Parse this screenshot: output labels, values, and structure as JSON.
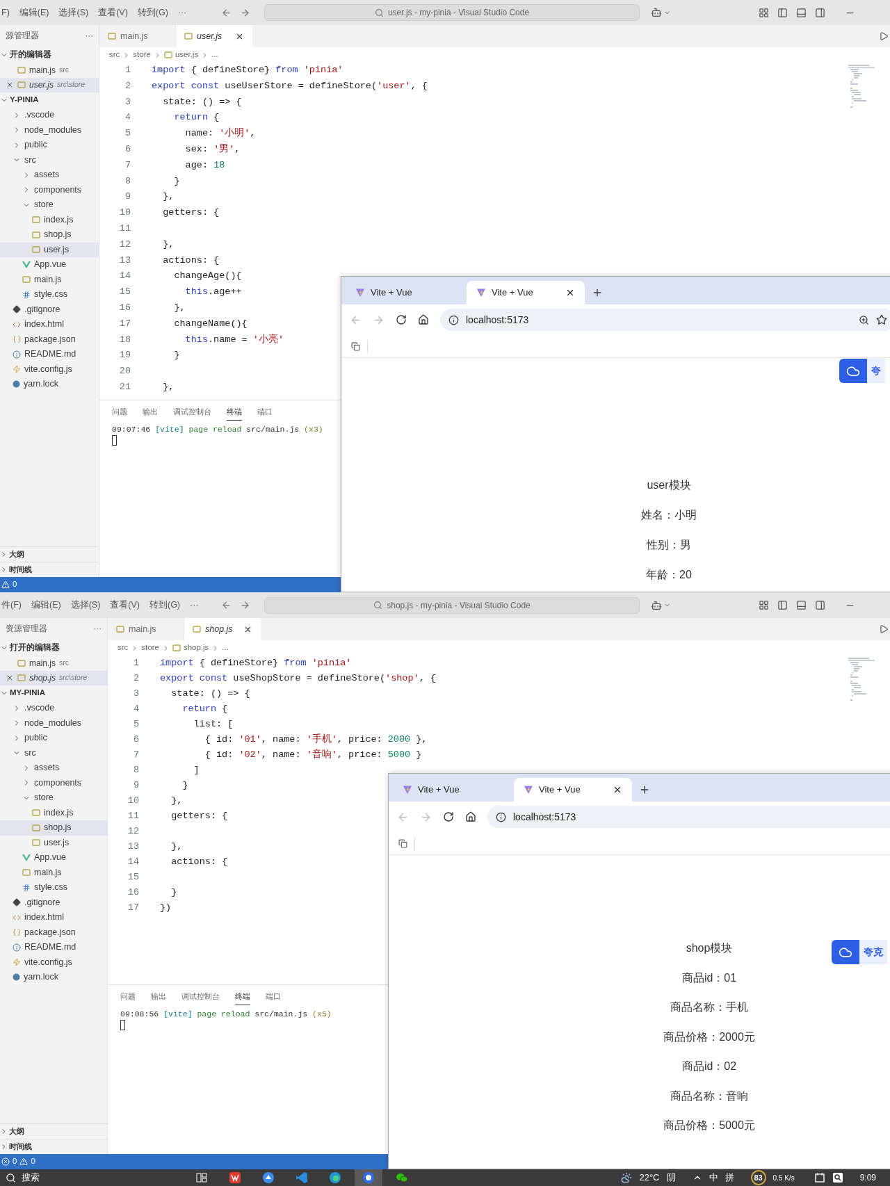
{
  "screens": [
    {
      "titlebar": {
        "menus": [
          "F)",
          "编辑(E)",
          "选择(S)",
          "查看(V)",
          "转到(G)"
        ],
        "more": "···",
        "search": "user.js - my-pinia - Visual Studio Code"
      },
      "explorer": {
        "title": "源管理器",
        "more": "···",
        "open_editors": {
          "title": "开的编辑器",
          "items": [
            {
              "name": "main.js",
              "path": "src",
              "selected": false,
              "preview": false
            },
            {
              "name": "user.js",
              "path": "src\\store",
              "selected": true,
              "preview": true
            }
          ]
        },
        "project": "Y-PINIA",
        "tree": [
          {
            "name": ".vscode",
            "kind": "folder",
            "expanded": false,
            "selected": false
          },
          {
            "name": "node_modules",
            "kind": "folder",
            "expanded": false,
            "selected": false
          },
          {
            "name": "public",
            "kind": "folder",
            "expanded": false,
            "selected": false
          },
          {
            "name": "src",
            "kind": "folder",
            "expanded": true,
            "selected": false,
            "children": [
              {
                "name": "assets",
                "kind": "folder",
                "expanded": false,
                "selected": false
              },
              {
                "name": "components",
                "kind": "folder",
                "expanded": false,
                "selected": false
              },
              {
                "name": "store",
                "kind": "folder",
                "expanded": true,
                "selected": false,
                "children": [
                  {
                    "name": "index.js",
                    "kind": "js",
                    "selected": false
                  },
                  {
                    "name": "shop.js",
                    "kind": "js",
                    "selected": false
                  },
                  {
                    "name": "user.js",
                    "kind": "js",
                    "selected": true
                  }
                ]
              },
              {
                "name": "App.vue",
                "kind": "vue",
                "selected": false
              },
              {
                "name": "main.js",
                "kind": "js",
                "selected": false
              },
              {
                "name": "style.css",
                "kind": "css",
                "selected": false
              }
            ]
          },
          {
            "name": ".gitignore",
            "kind": "git",
            "selected": false
          },
          {
            "name": "index.html",
            "kind": "html",
            "selected": false
          },
          {
            "name": "package.json",
            "kind": "json",
            "selected": false
          },
          {
            "name": "README.md",
            "kind": "md",
            "selected": false
          },
          {
            "name": "vite.config.js",
            "kind": "config",
            "selected": false
          },
          {
            "name": "yarn.lock",
            "kind": "lock",
            "selected": false
          }
        ],
        "outline": "大纲",
        "timeline": "时间线"
      },
      "tabs": [
        {
          "label": "main.js",
          "selected": false,
          "preview": false
        },
        {
          "label": "user.js",
          "selected": true,
          "preview": true
        }
      ],
      "breadcrumb": [
        "src",
        "store",
        "user.js",
        "..."
      ],
      "code": [
        {
          "number": "1",
          "tokens": [
            {
              "kind": "keyword",
              "text": "import"
            },
            {
              "kind": "plain",
              "text": " { defineStore} "
            },
            {
              "kind": "keyword",
              "text": "from "
            },
            {
              "kind": "string",
              "text": "'pinia'"
            }
          ]
        },
        {
          "number": "2",
          "tokens": [
            {
              "kind": "keyword",
              "text": "export const"
            },
            {
              "kind": "plain",
              "text": " useUserStore = defineStore("
            },
            {
              "kind": "string",
              "text": "'user'"
            },
            {
              "kind": "plain",
              "text": ", {"
            }
          ]
        },
        {
          "number": "3",
          "tokens": [
            {
              "kind": "plain",
              "text": "  state: () => {"
            }
          ]
        },
        {
          "number": "4",
          "tokens": [
            {
              "kind": "keyword",
              "text": "    return"
            },
            {
              "kind": "plain",
              "text": " {"
            }
          ]
        },
        {
          "number": "5",
          "tokens": [
            {
              "kind": "plain",
              "text": "      name: "
            },
            {
              "kind": "string",
              "text": "'小明'"
            },
            {
              "kind": "plain",
              "text": ","
            }
          ]
        },
        {
          "number": "6",
          "tokens": [
            {
              "kind": "plain",
              "text": "      sex: "
            },
            {
              "kind": "string",
              "text": "'男'"
            },
            {
              "kind": "plain",
              "text": ","
            }
          ]
        },
        {
          "number": "7",
          "tokens": [
            {
              "kind": "plain",
              "text": "      age: "
            },
            {
              "kind": "number",
              "text": "18"
            }
          ]
        },
        {
          "number": "8",
          "tokens": [
            {
              "kind": "plain",
              "text": "    }"
            }
          ]
        },
        {
          "number": "9",
          "tokens": [
            {
              "kind": "plain",
              "text": "  },"
            }
          ]
        },
        {
          "number": "10",
          "tokens": [
            {
              "kind": "plain",
              "text": "  getters: {"
            }
          ]
        },
        {
          "number": "11"
        },
        {
          "number": "12",
          "tokens": [
            {
              "kind": "plain",
              "text": "  },"
            }
          ]
        },
        {
          "number": "13",
          "tokens": [
            {
              "kind": "plain",
              "text": "  actions: {"
            }
          ]
        },
        {
          "number": "14",
          "tokens": [
            {
              "kind": "plain",
              "text": "    changeAge(){"
            }
          ]
        },
        {
          "number": "15",
          "tokens": [
            {
              "kind": "keyword",
              "text": "      this"
            },
            {
              "kind": "plain",
              "text": ".age++"
            }
          ]
        },
        {
          "number": "16",
          "tokens": [
            {
              "kind": "plain",
              "text": "    },"
            }
          ]
        },
        {
          "number": "17",
          "tokens": [
            {
              "kind": "plain",
              "text": "    changeName(){"
            }
          ]
        },
        {
          "number": "18",
          "tokens": [
            {
              "kind": "keyword",
              "text": "      this"
            },
            {
              "kind": "plain",
              "text": ".name = "
            },
            {
              "kind": "string",
              "text": "'小亮'"
            }
          ]
        },
        {
          "number": "19",
          "tokens": [
            {
              "kind": "plain",
              "text": "    }"
            }
          ]
        },
        {
          "number": "20"
        },
        {
          "number": "21",
          "tokens": [
            {
              "kind": "plain",
              "text": "  },"
            }
          ]
        }
      ],
      "panel": {
        "tabs": [
          {
            "label": "问题",
            "selected": false
          },
          {
            "label": "输出",
            "selected": false
          },
          {
            "label": "调试控制台",
            "selected": false
          },
          {
            "label": "终端",
            "selected": true
          },
          {
            "label": "端口",
            "selected": false
          }
        ],
        "terminal": [
          {
            "kind": "time",
            "text": "09:07:46"
          },
          {
            "kind": "tag",
            "text": "[vite]"
          },
          {
            "kind": "action",
            "text": "page reload"
          },
          {
            "kind": "path",
            "text": "src/main.js"
          },
          {
            "kind": "count",
            "text": "(x3)"
          }
        ]
      },
      "status": {
        "warnings": "0"
      },
      "browser": {
        "tabs": [
          {
            "title": "Vite + Vue",
            "selected": false
          },
          {
            "title": "Vite + Vue",
            "selected": true
          }
        ],
        "url": "localhost:5173",
        "extension": "夸",
        "lines": [
          "user模块",
          "姓名：小明",
          "性别：男",
          "年龄：20"
        ]
      }
    },
    {
      "titlebar": {
        "menus": [
          "件(F)",
          "编辑(E)",
          "选择(S)",
          "查看(V)",
          "转到(G)"
        ],
        "more": "···",
        "search": "shop.js - my-pinia - Visual Studio Code"
      },
      "explorer": {
        "title": "资源管理器",
        "more": "···",
        "open_editors": {
          "title": "打开的编辑器",
          "items": [
            {
              "name": "main.js",
              "path": "src",
              "selected": false,
              "preview": false
            },
            {
              "name": "shop.js",
              "path": "src\\store",
              "selected": true,
              "preview": true
            }
          ]
        },
        "project": "MY-PINIA",
        "tree": [
          {
            "name": ".vscode",
            "kind": "folder",
            "expanded": false,
            "selected": false
          },
          {
            "name": "node_modules",
            "kind": "folder",
            "expanded": false,
            "selected": false
          },
          {
            "name": "public",
            "kind": "folder",
            "expanded": false,
            "selected": false
          },
          {
            "name": "src",
            "kind": "folder",
            "expanded": true,
            "selected": false,
            "children": [
              {
                "name": "assets",
                "kind": "folder",
                "expanded": false,
                "selected": false
              },
              {
                "name": "components",
                "kind": "folder",
                "expanded": false,
                "selected": false
              },
              {
                "name": "store",
                "kind": "folder",
                "expanded": true,
                "selected": false,
                "children": [
                  {
                    "name": "index.js",
                    "kind": "js",
                    "selected": false
                  },
                  {
                    "name": "shop.js",
                    "kind": "js",
                    "selected": true
                  },
                  {
                    "name": "user.js",
                    "kind": "js",
                    "selected": false
                  }
                ]
              },
              {
                "name": "App.vue",
                "kind": "vue",
                "selected": false
              },
              {
                "name": "main.js",
                "kind": "js",
                "selected": false
              },
              {
                "name": "style.css",
                "kind": "css",
                "selected": false
              }
            ]
          },
          {
            "name": ".gitignore",
            "kind": "git",
            "selected": false
          },
          {
            "name": "index.html",
            "kind": "html",
            "selected": false
          },
          {
            "name": "package.json",
            "kind": "json",
            "selected": false
          },
          {
            "name": "README.md",
            "kind": "md",
            "selected": false
          },
          {
            "name": "vite.config.js",
            "kind": "config",
            "selected": false
          },
          {
            "name": "yarn.lock",
            "kind": "lock",
            "selected": false
          }
        ],
        "outline": "大纲",
        "timeline": "时间线"
      },
      "tabs": [
        {
          "label": "main.js",
          "selected": false,
          "preview": false
        },
        {
          "label": "shop.js",
          "selected": true,
          "preview": true
        }
      ],
      "breadcrumb": [
        "src",
        "store",
        "shop.js",
        "..."
      ],
      "code": [
        {
          "number": "1",
          "tokens": [
            {
              "kind": "keyword",
              "text": "import"
            },
            {
              "kind": "plain",
              "text": " { defineStore} "
            },
            {
              "kind": "keyword",
              "text": "from "
            },
            {
              "kind": "string",
              "text": "'pinia'"
            }
          ]
        },
        {
          "number": "2",
          "tokens": [
            {
              "kind": "keyword",
              "text": "export const"
            },
            {
              "kind": "plain",
              "text": " useShopStore = defineStore("
            },
            {
              "kind": "string",
              "text": "'shop'"
            },
            {
              "kind": "plain",
              "text": ", {"
            }
          ]
        },
        {
          "number": "3",
          "tokens": [
            {
              "kind": "plain",
              "text": "  state: () => {"
            }
          ]
        },
        {
          "number": "4",
          "tokens": [
            {
              "kind": "keyword",
              "text": "    return"
            },
            {
              "kind": "plain",
              "text": " {"
            }
          ]
        },
        {
          "number": "5",
          "tokens": [
            {
              "kind": "plain",
              "text": "      list: ["
            }
          ]
        },
        {
          "number": "6",
          "tokens": [
            {
              "kind": "plain",
              "text": "        { id: "
            },
            {
              "kind": "string",
              "text": "'01'"
            },
            {
              "kind": "plain",
              "text": ", name: "
            },
            {
              "kind": "string",
              "text": "'手机'"
            },
            {
              "kind": "plain",
              "text": ", price: "
            },
            {
              "kind": "number",
              "text": "2000"
            },
            {
              "kind": "plain",
              "text": " },"
            }
          ]
        },
        {
          "number": "7",
          "tokens": [
            {
              "kind": "plain",
              "text": "        { id: "
            },
            {
              "kind": "string",
              "text": "'02'"
            },
            {
              "kind": "plain",
              "text": ", name: "
            },
            {
              "kind": "string",
              "text": "'音响'"
            },
            {
              "kind": "plain",
              "text": ", price: "
            },
            {
              "kind": "number",
              "text": "5000"
            },
            {
              "kind": "plain",
              "text": " }"
            }
          ]
        },
        {
          "number": "8",
          "tokens": [
            {
              "kind": "plain",
              "text": "      ]"
            }
          ]
        },
        {
          "number": "9",
          "tokens": [
            {
              "kind": "plain",
              "text": "    }"
            }
          ]
        },
        {
          "number": "10",
          "tokens": [
            {
              "kind": "plain",
              "text": "  },"
            }
          ]
        },
        {
          "number": "11",
          "tokens": [
            {
              "kind": "plain",
              "text": "  getters: {"
            }
          ]
        },
        {
          "number": "12"
        },
        {
          "number": "13",
          "tokens": [
            {
              "kind": "plain",
              "text": "  },"
            }
          ]
        },
        {
          "number": "14",
          "tokens": [
            {
              "kind": "plain",
              "text": "  actions: {"
            }
          ]
        },
        {
          "number": "15"
        },
        {
          "number": "16",
          "tokens": [
            {
              "kind": "plain",
              "text": "  }"
            }
          ]
        },
        {
          "number": "17",
          "tokens": [
            {
              "kind": "plain",
              "text": "})"
            }
          ]
        }
      ],
      "panel": {
        "tabs": [
          {
            "label": "问题",
            "selected": false
          },
          {
            "label": "输出",
            "selected": false
          },
          {
            "label": "调试控制台",
            "selected": false
          },
          {
            "label": "终端",
            "selected": true
          },
          {
            "label": "端口",
            "selected": false
          }
        ],
        "terminal": [
          {
            "kind": "time",
            "text": "09:08:56"
          },
          {
            "kind": "tag",
            "text": "[vite]"
          },
          {
            "kind": "action",
            "text": "page reload"
          },
          {
            "kind": "path",
            "text": "src/main.js"
          },
          {
            "kind": "count",
            "text": "(x5)"
          }
        ]
      },
      "status": {
        "errors": "0",
        "warnings": "0"
      },
      "browser": {
        "tabs": [
          {
            "title": "Vite + Vue",
            "selected": false
          },
          {
            "title": "Vite + Vue",
            "selected": true
          }
        ],
        "url": "localhost:5173",
        "extension": "夸克",
        "lines": [
          "shop模块",
          "商品id：01",
          "商品名称：手机",
          "商品价格：2000元",
          "商品id：02",
          "商品名称：音响",
          "商品价格：5000元"
        ]
      }
    }
  ],
  "taskbar": {
    "search": "搜索",
    "apps": [
      {
        "kind": "taskview",
        "selected": false
      },
      {
        "kind": "office",
        "selected": false
      },
      {
        "kind": "bird",
        "selected": false
      },
      {
        "kind": "editor",
        "selected": false
      },
      {
        "kind": "web",
        "selected": false
      },
      {
        "kind": "browser",
        "selected": true
      },
      {
        "kind": "chat",
        "selected": false
      }
    ],
    "temperature": "22°C",
    "weather": "阴",
    "ime": [
      "中",
      "拼"
    ],
    "score": "83",
    "speed": "0.5 K/s",
    "clock": "9:09"
  }
}
